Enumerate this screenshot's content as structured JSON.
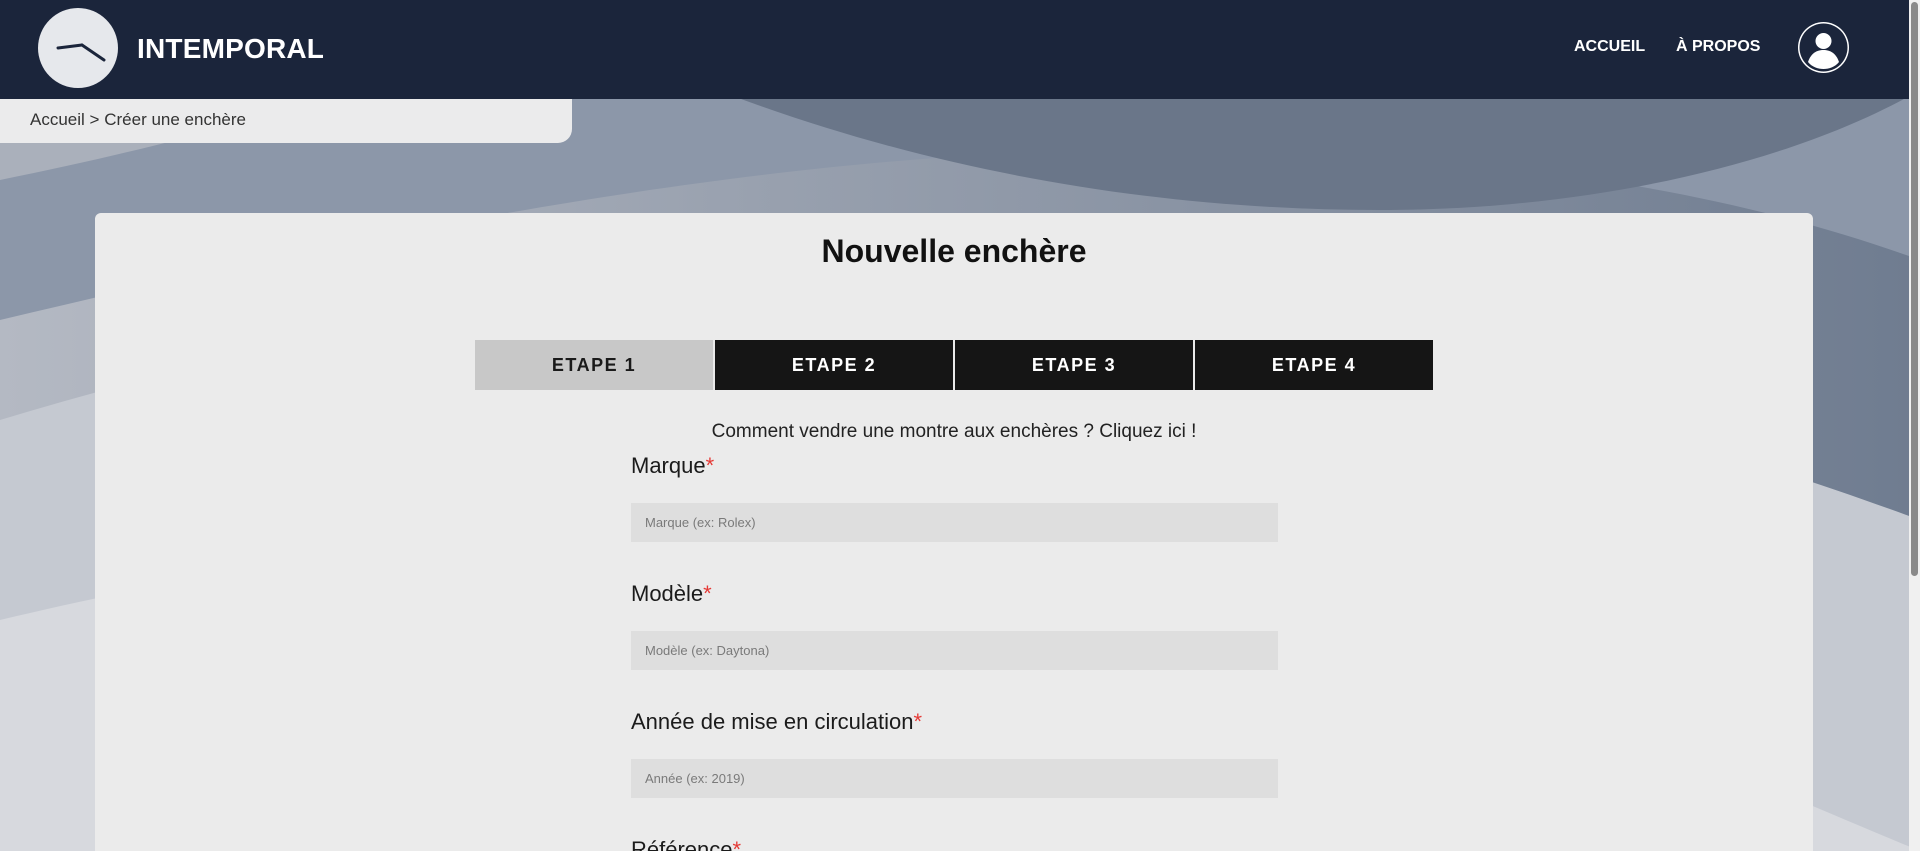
{
  "header": {
    "brand": "INTEMPORAL",
    "nav": {
      "home": "ACCUEIL",
      "about": "À PROPOS"
    },
    "logo_icon": "clock-hands-icon",
    "avatar_icon": "user-icon"
  },
  "breadcrumb": {
    "home": "Accueil",
    "separator": ">",
    "current": "Créer une enchère"
  },
  "page": {
    "title": "Nouvelle enchère",
    "steps": [
      "ETAPE 1",
      "ETAPE 2",
      "ETAPE 3",
      "ETAPE 4"
    ],
    "active_step": 1,
    "help_text": "Comment vendre une montre aux enchères ? Cliquez ici !"
  },
  "form": {
    "required_mark": "*",
    "fields": [
      {
        "label": "Marque",
        "placeholder": "Marque (ex: Rolex)",
        "value": ""
      },
      {
        "label": "Modèle",
        "placeholder": "Modèle (ex: Daytona)",
        "value": ""
      },
      {
        "label": "Année de mise en circulation",
        "placeholder": "Année (ex: 2019)",
        "value": ""
      },
      {
        "label": "Référence"
      }
    ]
  },
  "colors": {
    "header_bg": "#1b253b",
    "step_active_bg": "#c8c8c8",
    "step_inactive_bg": "#151515",
    "required": "#e53935",
    "card_bg": "#ebebeb"
  }
}
